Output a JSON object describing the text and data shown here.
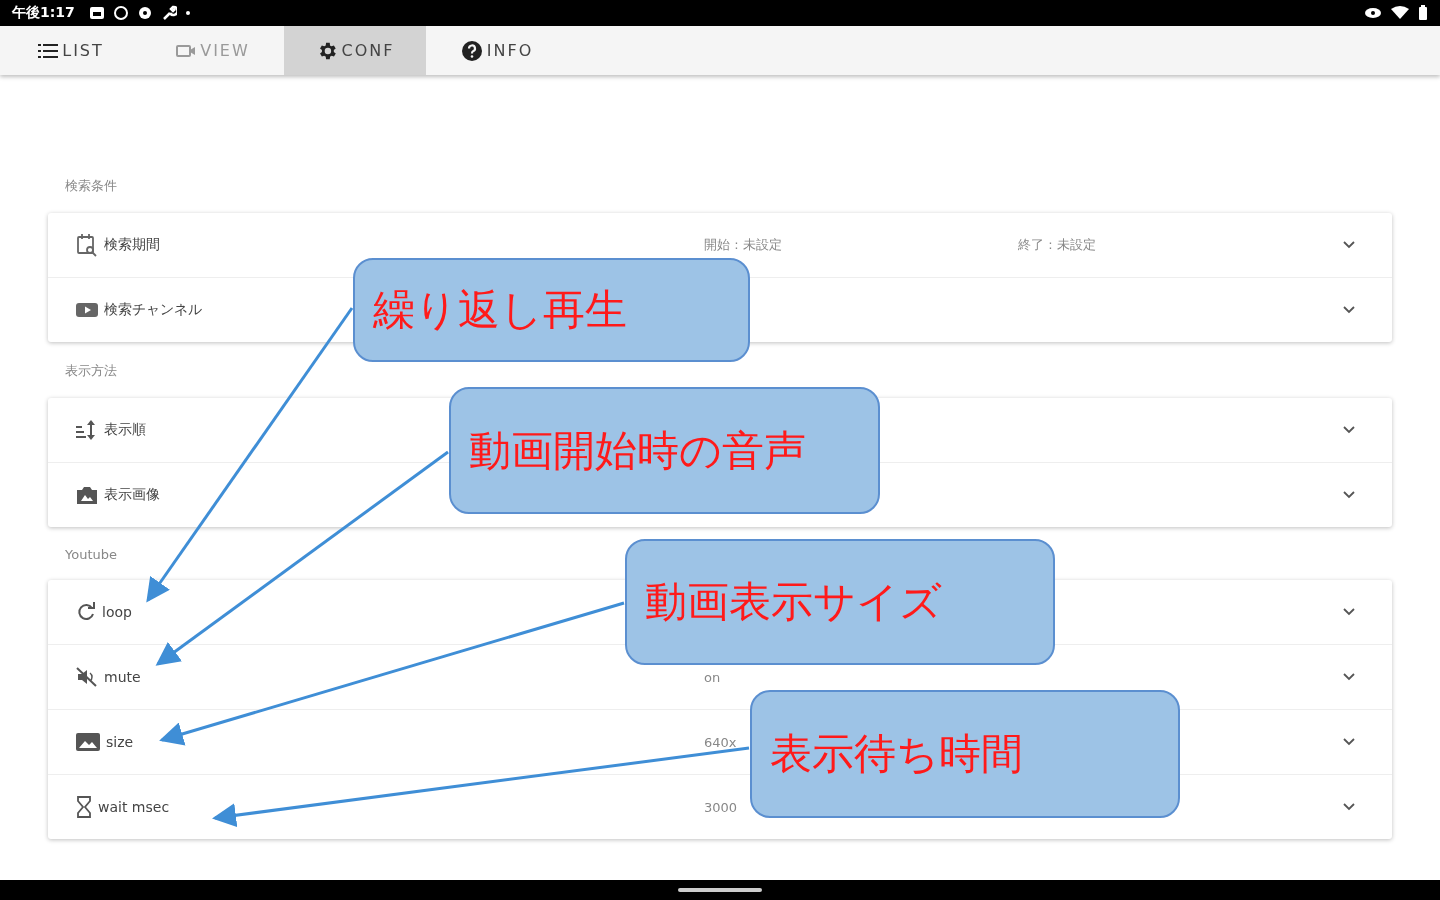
{
  "status_bar": {
    "time": "午後1:17"
  },
  "tabs": [
    {
      "label": "LIST",
      "selected": false,
      "disabled": false
    },
    {
      "label": "VIEW",
      "selected": false,
      "disabled": true
    },
    {
      "label": "CONF",
      "selected": true,
      "disabled": false
    },
    {
      "label": "INFO",
      "selected": false,
      "disabled": false
    }
  ],
  "sections": [
    {
      "title": "検索条件",
      "rows": [
        {
          "label": "検索期間",
          "values": [
            "開始 : 未設定",
            "終了 : 未設定"
          ]
        },
        {
          "label": "検索チャンネル",
          "values": []
        }
      ]
    },
    {
      "title": "表示方法",
      "rows": [
        {
          "label": "表示順",
          "values": []
        },
        {
          "label": "表示画像",
          "values": []
        }
      ]
    },
    {
      "title": "Youtube",
      "rows": [
        {
          "label": "loop",
          "values": []
        },
        {
          "label": "mute",
          "values": [
            "on"
          ]
        },
        {
          "label": "size",
          "values": [
            "640x"
          ]
        },
        {
          "label": "wait msec",
          "values": [
            "3000"
          ]
        }
      ]
    }
  ],
  "callouts": [
    {
      "text": "繰り返し再生"
    },
    {
      "text": "動画開始時の音声"
    },
    {
      "text": "動画表示サイズ"
    },
    {
      "text": "表示待ち時間"
    }
  ]
}
